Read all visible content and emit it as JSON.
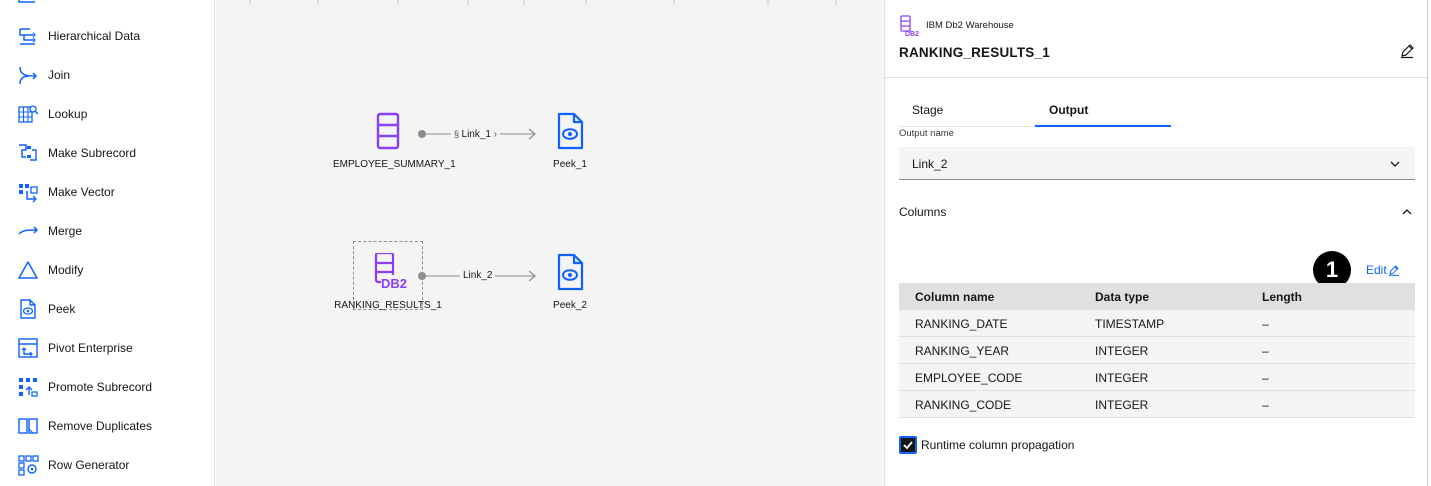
{
  "palette": {
    "items": [
      {
        "label": "Hierarchical Data",
        "icon": "hierarchical-data-icon"
      },
      {
        "label": "Join",
        "icon": "join-icon"
      },
      {
        "label": "Lookup",
        "icon": "lookup-icon"
      },
      {
        "label": "Make Subrecord",
        "icon": "make-subrecord-icon"
      },
      {
        "label": "Make Vector",
        "icon": "make-vector-icon"
      },
      {
        "label": "Merge",
        "icon": "merge-icon"
      },
      {
        "label": "Modify",
        "icon": "modify-icon"
      },
      {
        "label": "Peek",
        "icon": "peek-icon"
      },
      {
        "label": "Pivot Enterprise",
        "icon": "pivot-enterprise-icon"
      },
      {
        "label": "Promote Subrecord",
        "icon": "promote-subrecord-icon"
      },
      {
        "label": "Remove Duplicates",
        "icon": "remove-duplicates-icon"
      },
      {
        "label": "Row Generator",
        "icon": "row-generator-icon"
      }
    ]
  },
  "canvas": {
    "nodes": {
      "employee_summary": "EMPLOYEE_SUMMARY_1",
      "peek1": "Peek_1",
      "ranking_results": "RANKING_RESULTS_1",
      "peek2": "Peek_2"
    },
    "links": {
      "link1": "Link_1",
      "link2": "Link_2"
    }
  },
  "panel": {
    "connector_type": "IBM Db2 Warehouse",
    "stage_name": "RANKING_RESULTS_1",
    "tabs": [
      {
        "label": "Stage",
        "selected": false
      },
      {
        "label": "Output",
        "selected": true
      }
    ],
    "output_name_label": "Output name",
    "output_name_value": "Link_2",
    "columns_title": "Columns",
    "edit_label": "Edit",
    "badge": "1",
    "table": {
      "headers": [
        "Column name",
        "Data type",
        "Length"
      ],
      "rows": [
        [
          "RANKING_DATE",
          "TIMESTAMP",
          "–"
        ],
        [
          "RANKING_YEAR",
          "INTEGER",
          "–"
        ],
        [
          "EMPLOYEE_CODE",
          "INTEGER",
          "–"
        ],
        [
          "RANKING_CODE",
          "INTEGER",
          "–"
        ]
      ]
    },
    "runtime_propagation_label": "Runtime column propagation",
    "runtime_propagation_checked": true
  },
  "colors": {
    "accent_blue": "#0f62fe",
    "icon_blue": "#0f62fe",
    "db2_purple": "#8a3ffc"
  }
}
